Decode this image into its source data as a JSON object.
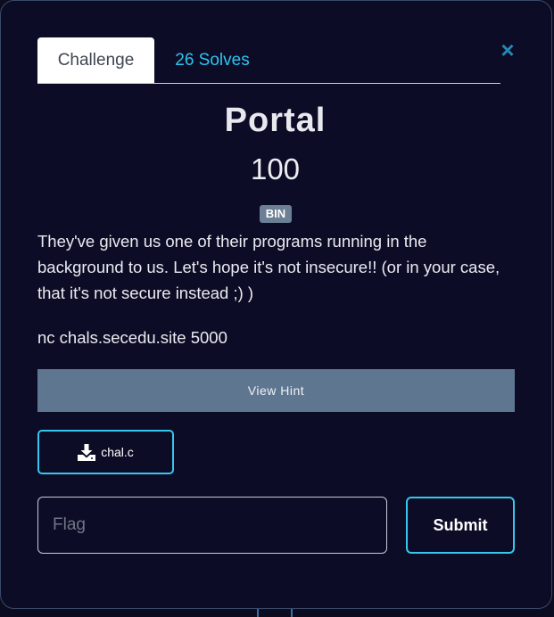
{
  "tabs": {
    "challenge": "Challenge",
    "solves": "26 Solves"
  },
  "close_icon": "×",
  "challenge": {
    "name": "Portal",
    "points": "100",
    "tag": "BIN",
    "description": "They've given us one of their programs running in the background to us. Let's hope it's not insecure!! (or in your case, that it's not secure instead ;) )",
    "connection": "nc chals.secedu.site 5000"
  },
  "hint_button": "View Hint",
  "file": {
    "name": "chal.c",
    "icon": "download-icon"
  },
  "flag": {
    "placeholder": "Flag",
    "value": ""
  },
  "submit_label": "Submit",
  "colors": {
    "accent": "#35c7ee",
    "hint_bg": "#5f7691",
    "modal_bg": "#0d0c26",
    "tag_bg": "#6c7f95"
  }
}
